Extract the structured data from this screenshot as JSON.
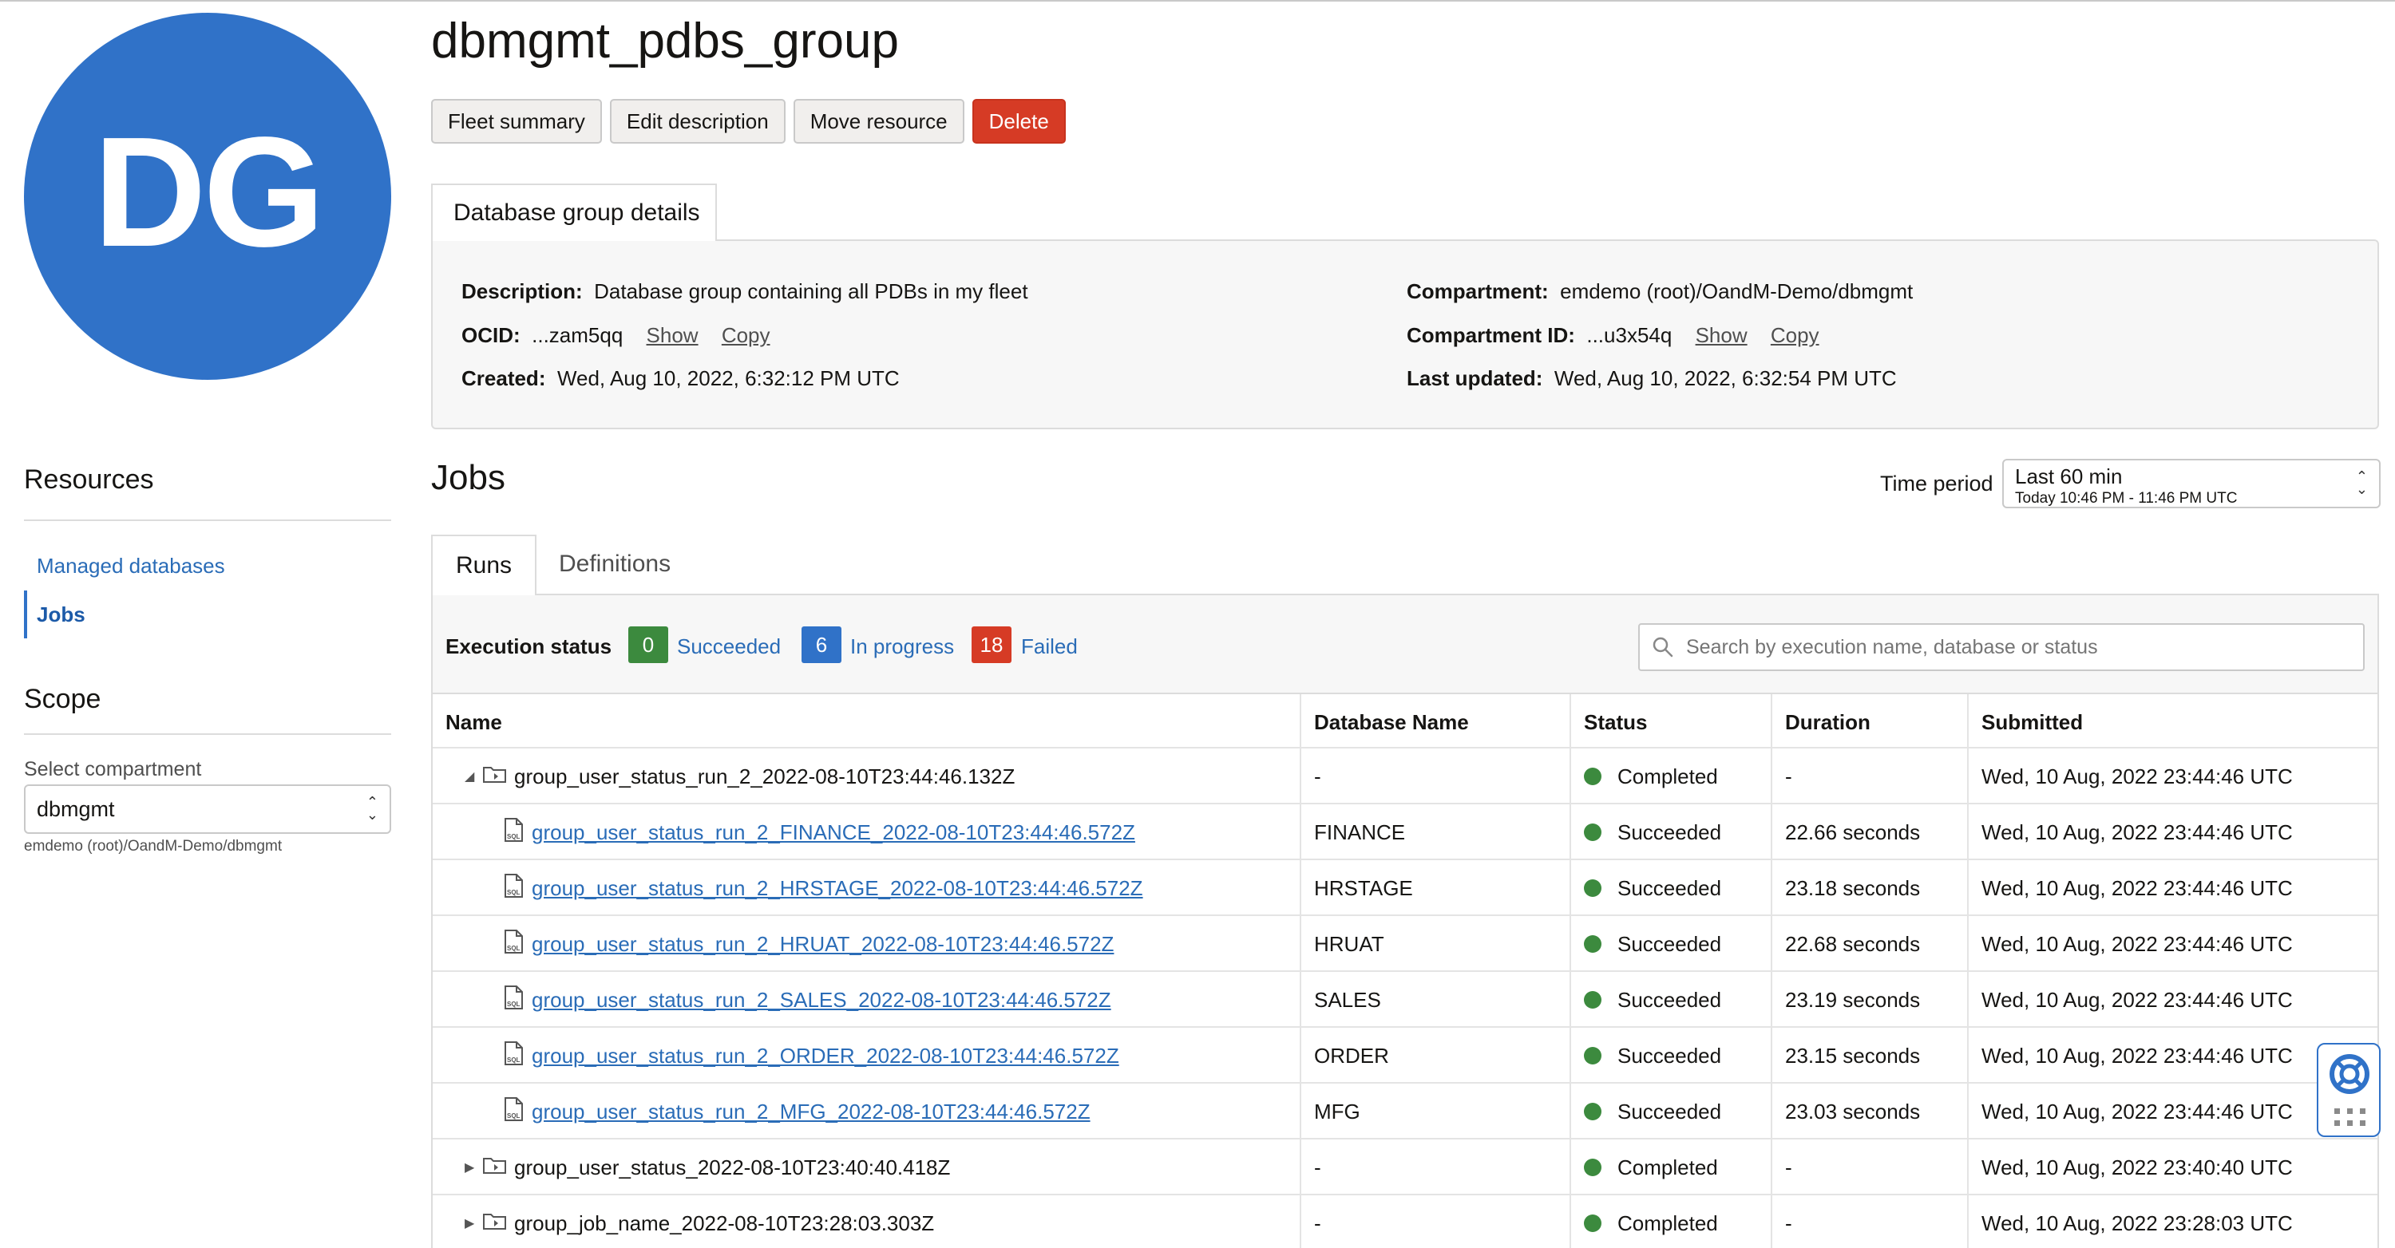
{
  "avatar": {
    "initials": "DG",
    "color": "#3072c8"
  },
  "header": {
    "title": "dbmgmt_pdbs_group",
    "buttons": {
      "fleet_summary": "Fleet summary",
      "edit_description": "Edit description",
      "move_resource": "Move resource",
      "delete": "Delete"
    }
  },
  "details": {
    "tab": "Database group details",
    "description_label": "Description:",
    "description": "Database group containing all PDBs in my fleet",
    "ocid_label": "OCID:",
    "ocid": "...zam5qq",
    "created_label": "Created:",
    "created": "Wed, Aug 10, 2022, 6:32:12 PM UTC",
    "compartment_label": "Compartment:",
    "compartment": "emdemo (root)/OandM-Demo/dbmgmt",
    "compartment_id_label": "Compartment ID:",
    "compartment_id": "...u3x54q",
    "last_updated_label": "Last updated:",
    "last_updated": "Wed, Aug 10, 2022, 6:32:54 PM UTC",
    "show": "Show",
    "copy": "Copy"
  },
  "sidebar": {
    "resources_heading": "Resources",
    "items": [
      {
        "label": "Managed databases",
        "active": false
      },
      {
        "label": "Jobs",
        "active": true
      }
    ],
    "scope_heading": "Scope",
    "select_compartment_label": "Select compartment",
    "compartment_value": "dbmgmt",
    "compartment_path": "emdemo (root)/OandM-Demo/dbmgmt"
  },
  "jobs": {
    "heading": "Jobs",
    "time_period_label": "Time period",
    "time_period_value": "Last 60 min",
    "time_period_range": "Today 10:46 PM - 11:46 PM UTC",
    "tabs": {
      "runs": "Runs",
      "definitions": "Definitions"
    },
    "execution_status_label": "Execution status",
    "succeeded": {
      "count": "0",
      "label": "Succeeded",
      "color": "#3c8a3e"
    },
    "in_progress": {
      "count": "6",
      "label": "In progress",
      "color": "#3072c8"
    },
    "failed": {
      "count": "18",
      "label": "Failed",
      "color": "#d63b25"
    },
    "search_placeholder": "Search by execution name, database or status",
    "columns": {
      "name": "Name",
      "database": "Database Name",
      "status": "Status",
      "duration": "Duration",
      "submitted": "Submitted"
    },
    "rows": [
      {
        "name": "group_user_status_run_2_2022-08-10T23:44:46.132Z",
        "database": "-",
        "status": "Completed",
        "duration": "-",
        "submitted": "Wed, 10 Aug, 2022 23:44:46 UTC"
      },
      {
        "name": "group_user_status_run_2_FINANCE_2022-08-10T23:44:46.572Z",
        "database": "FINANCE",
        "status": "Succeeded",
        "duration": "22.66 seconds",
        "submitted": "Wed, 10 Aug, 2022 23:44:46 UTC"
      },
      {
        "name": "group_user_status_run_2_HRSTAGE_2022-08-10T23:44:46.572Z",
        "database": "HRSTAGE",
        "status": "Succeeded",
        "duration": "23.18 seconds",
        "submitted": "Wed, 10 Aug, 2022 23:44:46 UTC"
      },
      {
        "name": "group_user_status_run_2_HRUAT_2022-08-10T23:44:46.572Z",
        "database": "HRUAT",
        "status": "Succeeded",
        "duration": "22.68 seconds",
        "submitted": "Wed, 10 Aug, 2022 23:44:46 UTC"
      },
      {
        "name": "group_user_status_run_2_SALES_2022-08-10T23:44:46.572Z",
        "database": "SALES",
        "status": "Succeeded",
        "duration": "23.19 seconds",
        "submitted": "Wed, 10 Aug, 2022 23:44:46 UTC"
      },
      {
        "name": "group_user_status_run_2_ORDER_2022-08-10T23:44:46.572Z",
        "database": "ORDER",
        "status": "Succeeded",
        "duration": "23.15 seconds",
        "submitted": "Wed, 10 Aug, 2022 23:44:46 UTC"
      },
      {
        "name": "group_user_status_run_2_MFG_2022-08-10T23:44:46.572Z",
        "database": "MFG",
        "status": "Succeeded",
        "duration": "23.03 seconds",
        "submitted": "Wed, 10 Aug, 2022 23:44:46 UTC"
      },
      {
        "name": "group_user_status_2022-08-10T23:40:40.418Z",
        "database": "-",
        "status": "Completed",
        "duration": "-",
        "submitted": "Wed, 10 Aug, 2022 23:40:40 UTC"
      },
      {
        "name": "group_job_name_2022-08-10T23:28:03.303Z",
        "database": "-",
        "status": "Completed",
        "duration": "-",
        "submitted": "Wed, 10 Aug, 2022 23:28:03 UTC"
      }
    ]
  },
  "icons": {
    "search": "search-icon",
    "folder": "folder-icon",
    "sql": "sql-file-icon",
    "help": "lifebuoy-icon"
  }
}
